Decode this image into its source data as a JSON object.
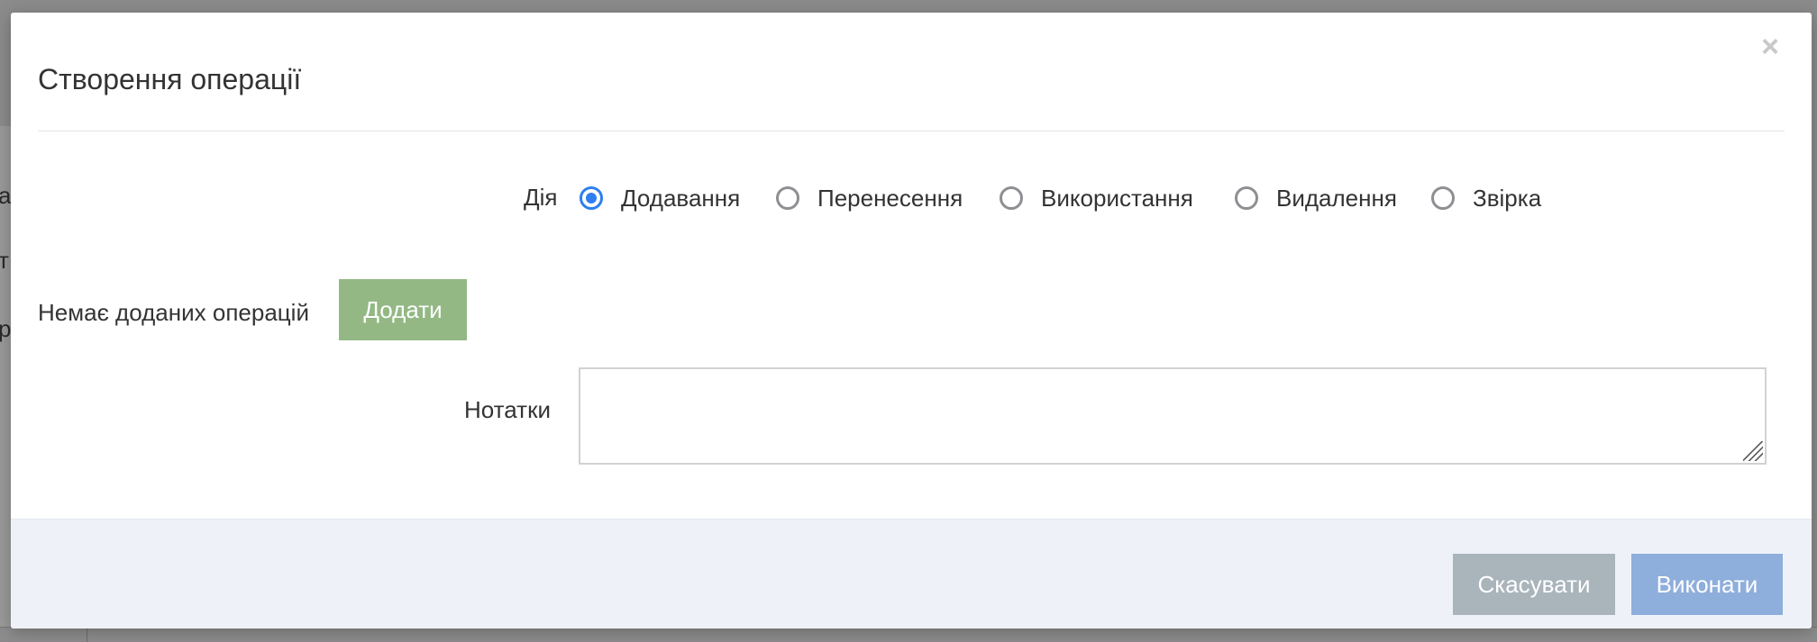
{
  "background": {
    "fragments": [
      "а",
      "т",
      "р"
    ]
  },
  "modal": {
    "title": "Створення операції",
    "close_label": "×"
  },
  "action": {
    "label": "Дія",
    "options": [
      {
        "label": "Додавання",
        "checked": true
      },
      {
        "label": "Перенесення",
        "checked": false
      },
      {
        "label": "Використання",
        "checked": false
      },
      {
        "label": "Видалення",
        "checked": false
      },
      {
        "label": "Звірка",
        "checked": false
      }
    ]
  },
  "operations": {
    "empty_text": "Немає доданих операцій",
    "add_label": "Додати"
  },
  "notes": {
    "label": "Нотатки",
    "value": "",
    "placeholder": ""
  },
  "footer": {
    "cancel_label": "Скасувати",
    "submit_label": "Виконати"
  },
  "colors": {
    "radio_checked": "#2f7ef0",
    "add_button": "#93b884",
    "cancel_button": "#a9b4bb",
    "submit_button": "#8eaedc",
    "footer_bg": "#eef2f8"
  }
}
